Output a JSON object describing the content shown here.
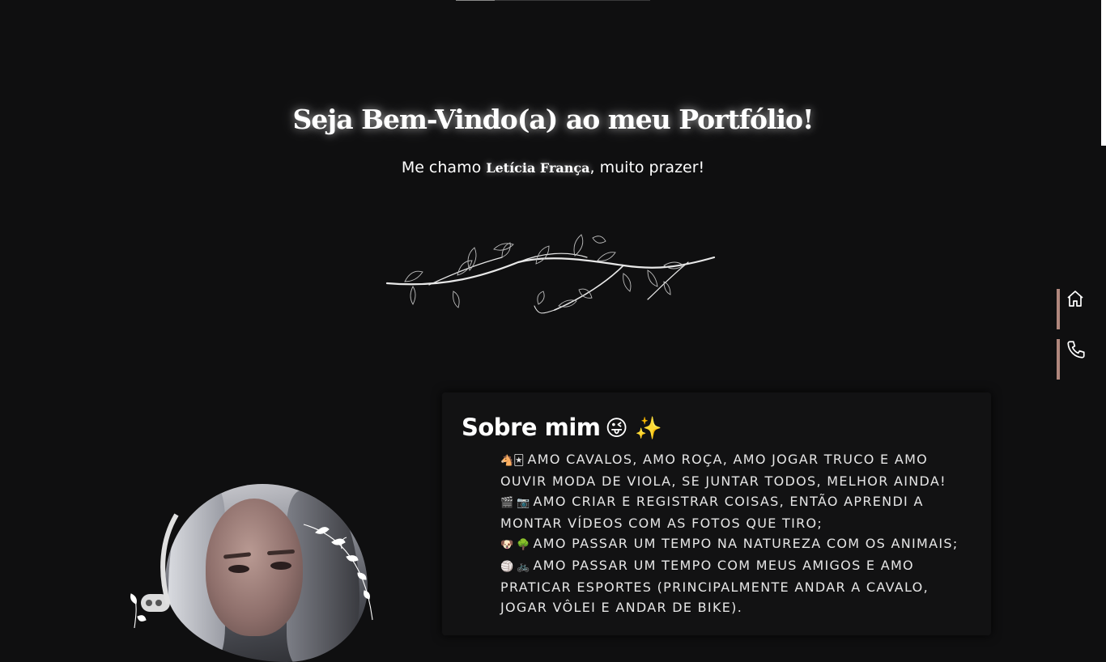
{
  "hero": {
    "title": "Seja Bem-Vindo(a) ao meu Portfólio!",
    "subtitle_before": "Me chamo ",
    "name": "Letícia França",
    "subtitle_after": ", muito prazer!"
  },
  "side_nav": {
    "items": [
      {
        "icon": "home-icon"
      },
      {
        "icon": "phone-icon"
      }
    ],
    "accent_color": "#b0877d"
  },
  "about": {
    "title": "Sobre mim",
    "title_emoji": "😜 ✨",
    "items": [
      {
        "icons": "🐴🃏",
        "text": "Amo cavalos, amo roça, amo jogar truco e amo ouvir moda de viola, se juntar todos, melhor ainda!"
      },
      {
        "icons": "🎬 📷",
        "text": "Amo criar e registrar coisas, então aprendi a montar vídeos com as fotos que tiro;"
      },
      {
        "icons": "🐶 🌳",
        "text": "Amo passar um tempo na natureza com os animais;"
      },
      {
        "icons": "🏐 🚲",
        "text": "Amo passar um tempo com meus amigos e amo praticar esportes (principalmente andar a cavalo, jogar vôlei e andar de bike)."
      }
    ]
  },
  "colors": {
    "background": "#0f0f10",
    "card": "#121213",
    "text": "#ffffff"
  }
}
